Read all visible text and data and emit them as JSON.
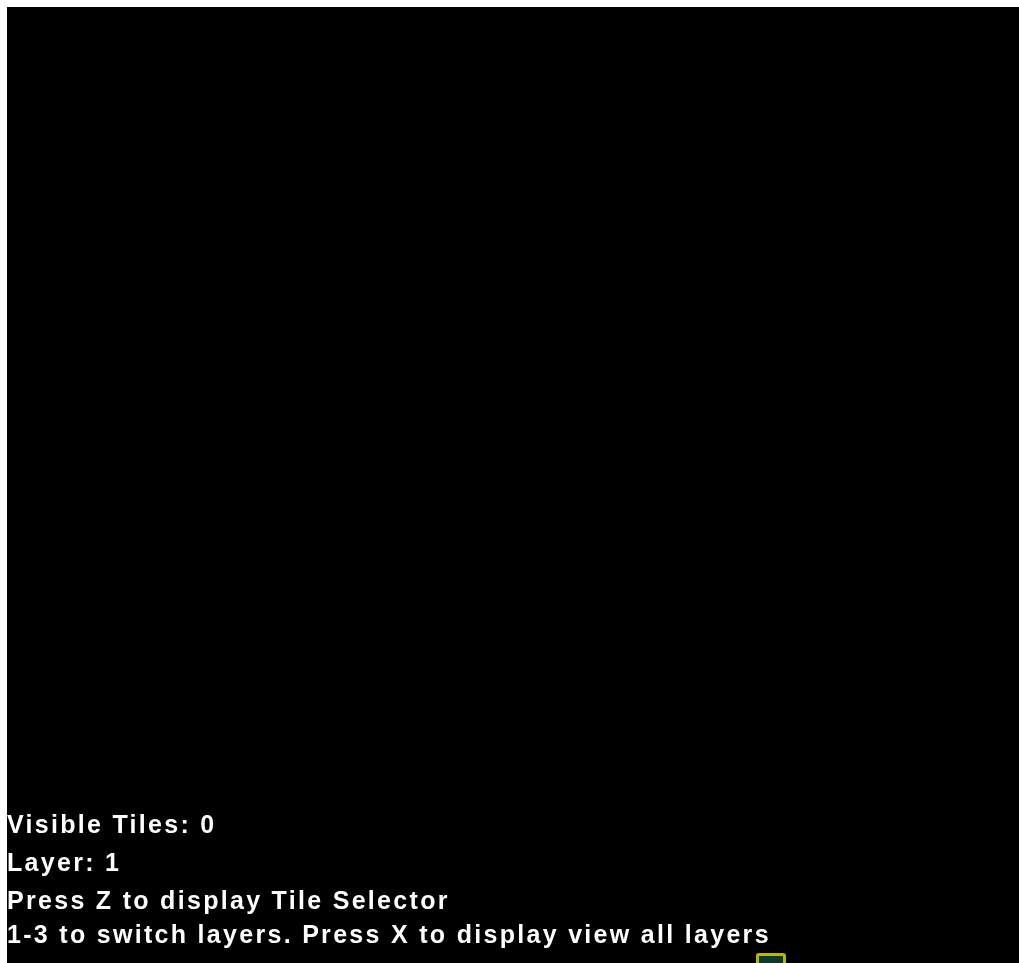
{
  "hud": {
    "lines": [
      "Visible Tiles: 0",
      "Layer: 1",
      "Press Z to display Tile Selector",
      "1-3 to switch layers. Press X to display view all layers"
    ]
  }
}
